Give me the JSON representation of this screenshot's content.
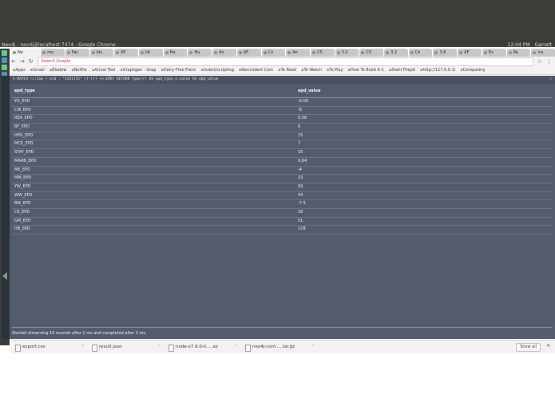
{
  "window": {
    "title": "Neo4j - neo4j@localhost:7474 - Google Chrome"
  },
  "tray": {
    "time": "12:04 PM",
    "user": "Garrett"
  },
  "tabs": [
    {
      "label": "Ne",
      "active": true
    },
    {
      "label": "mo"
    },
    {
      "label": "Fac"
    },
    {
      "label": "blu"
    },
    {
      "label": "AF"
    },
    {
      "label": "lib"
    },
    {
      "label": "Ho"
    },
    {
      "label": "Hu"
    },
    {
      "label": "An"
    },
    {
      "label": "AF"
    },
    {
      "label": "Co"
    },
    {
      "label": "An"
    },
    {
      "label": "CS"
    },
    {
      "label": "3.2"
    },
    {
      "label": "CS"
    },
    {
      "label": "3.2"
    },
    {
      "label": "Co"
    },
    {
      "label": "3.6"
    },
    {
      "label": "AF"
    },
    {
      "label": "Ex"
    },
    {
      "label": "Re"
    },
    {
      "label": "ins"
    }
  ],
  "omnibox": {
    "placeholder": "Search Google"
  },
  "bookmarks": [
    "Apps",
    "Gmail",
    "Bladow",
    "Netflix",
    "Arrow Tool",
    "Graphgen - Grap",
    "Dairy-Free Frenc",
    "hubot/scripting",
    "Nonviolent Com",
    "To Read",
    "To Watch",
    "To Play",
    "How To Build A C",
    "Stahl Firepit",
    "http://127.0.0.1/",
    "Computery"
  ],
  "neo": {
    "command": "$ MATCH (c:Cow { eid : \"1331735\" })-[r]-(e:EPD) RETURN type(r) AS epd_type,e.value AS epd_value",
    "headers": {
      "c1": "epd_type",
      "c2": "epd_value"
    },
    "rows": [
      {
        "epd_type": "YG_EPD",
        "epd_value": "-0.09"
      },
      {
        "epd_type": "CW_EPD",
        "epd_value": "-6"
      },
      {
        "epd_type": "REA_EPD",
        "epd_value": "0.08"
      },
      {
        "epd_type": "BF_EPD",
        "epd_value": "0"
      },
      {
        "epd_type": "HPG_EPD",
        "epd_value": "15"
      },
      {
        "epd_type": "MCE_EPD",
        "epd_value": "7"
      },
      {
        "epd_type": "STAY_EPD",
        "epd_value": "15"
      },
      {
        "epd_type": "MARB_EPD",
        "epd_value": "0.64"
      },
      {
        "epd_type": "ME_EPD",
        "epd_value": "-4"
      },
      {
        "epd_type": "MM_EPD",
        "epd_value": "23"
      },
      {
        "epd_type": "YW_EPD",
        "epd_value": "59"
      },
      {
        "epd_type": "WW_EPD",
        "epd_value": "43"
      },
      {
        "epd_type": "BW_EPD",
        "epd_value": "-7.5"
      },
      {
        "epd_type": "CE_EPD",
        "epd_value": "16"
      },
      {
        "epd_type": "GM_EPD",
        "epd_value": "51"
      },
      {
        "epd_type": "HB_EPD",
        "epd_value": "178"
      }
    ],
    "status": "Started streaming 16 records after 1 ms and completed after 3 ms."
  },
  "downloads": {
    "items": [
      "export.csv",
      "result.json",
      "node-v7.9.0-li.....xz",
      "neo4j-com.....tar.gz"
    ],
    "show_all": "Show all"
  }
}
